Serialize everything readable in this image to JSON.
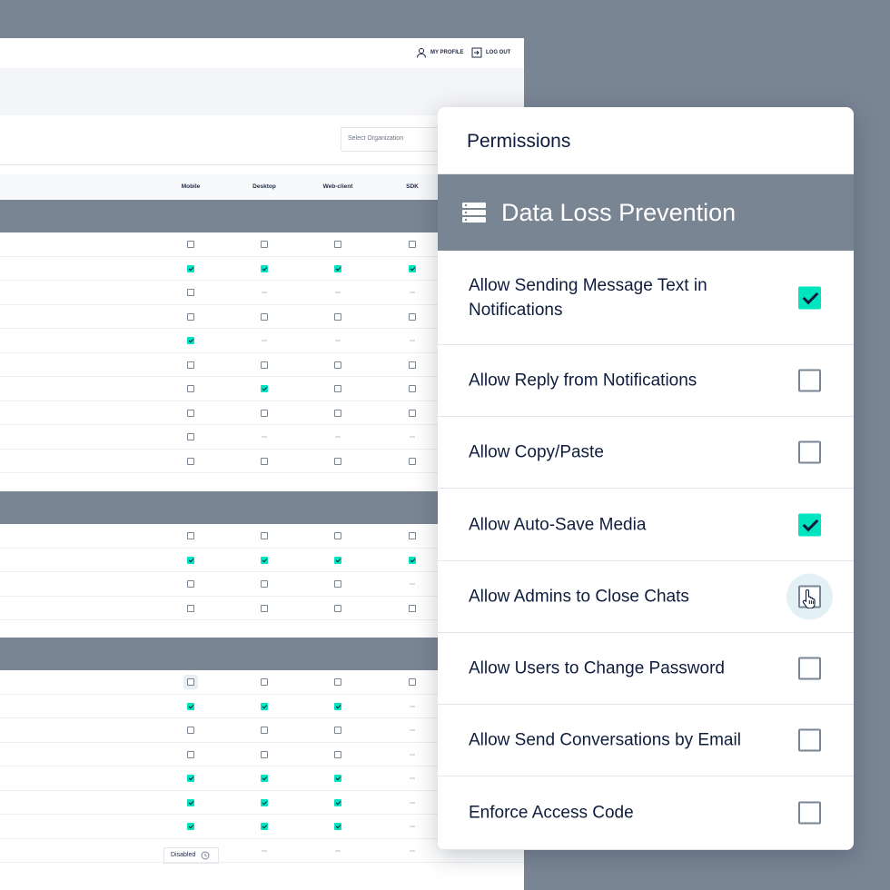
{
  "top_bar": {
    "my_profile": "MY PROFILE",
    "log_out": "LOG OUT"
  },
  "select_organization": {
    "placeholder": "Select Organization"
  },
  "columns": [
    "Mobile",
    "Desktop",
    "Web-client",
    "SDK"
  ],
  "background_table": {
    "sections": [
      {
        "rows": [
          [
            "off",
            "off",
            "off",
            "off"
          ],
          [
            "on",
            "on",
            "on",
            "on"
          ],
          [
            "off",
            "na",
            "na",
            "na"
          ],
          [
            "off",
            "off",
            "off",
            "off"
          ],
          [
            "on",
            "na",
            "na",
            "na"
          ],
          [
            "off",
            "off",
            "off",
            "off"
          ],
          [
            "off",
            "on",
            "off",
            "off"
          ],
          [
            "off",
            "off",
            "off",
            "off"
          ],
          [
            "off",
            "na",
            "na",
            "na"
          ],
          [
            "off",
            "off",
            "off",
            "off"
          ]
        ]
      },
      {
        "rows": [
          [
            "off",
            "off",
            "off",
            "off"
          ],
          [
            "on",
            "on",
            "on",
            "on"
          ],
          [
            "off",
            "off",
            "off",
            "na"
          ],
          [
            "off",
            "off",
            "off",
            "off"
          ]
        ]
      },
      {
        "rows": [
          [
            "hover",
            "off",
            "off",
            "off"
          ],
          [
            "on",
            "on",
            "on",
            "na"
          ],
          [
            "off",
            "off",
            "off",
            "na"
          ],
          [
            "off",
            "off",
            "off",
            "na"
          ],
          [
            "on",
            "on",
            "on",
            "na"
          ],
          [
            "on",
            "on",
            "on",
            "na"
          ],
          [
            "on",
            "on",
            "on",
            "na"
          ],
          [
            "disabled",
            "na",
            "na",
            "na"
          ]
        ]
      }
    ],
    "disabled_label": "Disabled"
  },
  "permissions_card": {
    "title": "Permissions",
    "section_title": "Data Loss Prevention",
    "section_icon": "server-stack-icon",
    "items": [
      {
        "label": "Allow Sending Message Text in Notifications",
        "checked": true
      },
      {
        "label": "Allow Reply from Notifications",
        "checked": false
      },
      {
        "label": "Allow Copy/Paste",
        "checked": false
      },
      {
        "label": "Allow Auto-Save Media",
        "checked": true
      },
      {
        "label": "Allow Admins to Close Chats",
        "checked": false,
        "hovered": true
      },
      {
        "label": "Allow Users to Change Password",
        "checked": false
      },
      {
        "label": "Allow Send Conversations by Email",
        "checked": false
      },
      {
        "label": "Enforce Access Code",
        "checked": false
      }
    ]
  },
  "colors": {
    "accent": "#00e5c0",
    "section_band": "#7a8594",
    "text_dark": "#0f1d3d"
  }
}
